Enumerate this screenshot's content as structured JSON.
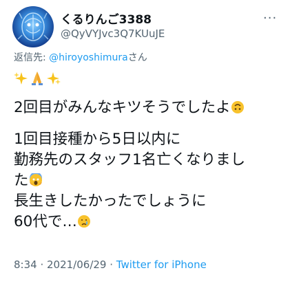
{
  "author": {
    "display_name": "くるりんご3388",
    "handle": "@QyVYJvc3Q7KUuJE"
  },
  "more_label": "···",
  "reply": {
    "prefix": "返信先: ",
    "mention": "@hiroyoshimura",
    "suffix": "さん"
  },
  "tweet": {
    "line1": "2回目がみんなキツそうでしたよ",
    "line2": "1回目接種から5日以内に",
    "line3": "勤務先のスタッフ1名亡くなりまし",
    "line4": "た",
    "line5": "長生きしたかったでしょうに",
    "line6": "60代で…"
  },
  "footer": {
    "time": "8:34",
    "separator1": " · ",
    "date": "2021/06/29",
    "separator2": " · ",
    "source": "Twitter for iPhone"
  },
  "colors": {
    "accent": "#1d9bf0",
    "text": "#0f1419",
    "secondary": "#536471"
  },
  "icons": [
    "sparkles-icon",
    "folded-hands-icon",
    "upside-down-face-icon",
    "screaming-face-icon",
    "crying-face-icon"
  ]
}
